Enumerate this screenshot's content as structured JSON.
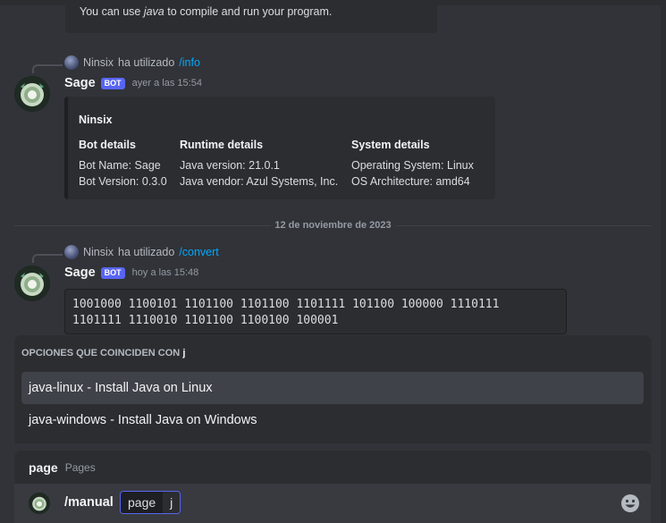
{
  "previous_embed": {
    "line_prefix": "You can use ",
    "line_italic": "java",
    "line_suffix": " to compile and run your program."
  },
  "message1": {
    "reply_user": "Ninsix",
    "reply_text": "ha utilizado",
    "reply_command": "/info",
    "author": "Sage",
    "bot_tag": "BOT",
    "timestamp": "ayer a las 15:54",
    "embed": {
      "title": "Ninsix",
      "fields": [
        {
          "name": "Bot details",
          "lines": [
            "Bot Name: Sage",
            "Bot Version: 0.3.0"
          ]
        },
        {
          "name": "Runtime details",
          "lines": [
            "Java version: 21.0.1",
            "Java vendor: Azul Systems, Inc."
          ]
        },
        {
          "name": "System details",
          "lines": [
            "Operating System: Linux",
            "OS Architecture: amd64"
          ]
        }
      ]
    }
  },
  "date_divider": "12 de noviembre de 2023",
  "message2": {
    "reply_user": "Ninsix",
    "reply_text": "ha utilizado",
    "reply_command": "/convert",
    "author": "Sage",
    "bot_tag": "BOT",
    "timestamp": "hoy a las 15:48",
    "code_line1": "1001000 1100101 1101100 1101100 1101111 101100 100000 1110111",
    "code_line2": "1101111 1110010 1101100 1100100 100001"
  },
  "autocomplete": {
    "header_prefix": "OPCIONES QUE COINCIDEN CON",
    "header_query": "j",
    "items": [
      {
        "label": "java-linux - Install Java on Linux"
      },
      {
        "label": "java-windows - Install Java on Windows"
      }
    ]
  },
  "option_hint": {
    "name": "page",
    "description": "Pages"
  },
  "input": {
    "command": "/manual",
    "param_name": "page",
    "param_value": "j"
  }
}
